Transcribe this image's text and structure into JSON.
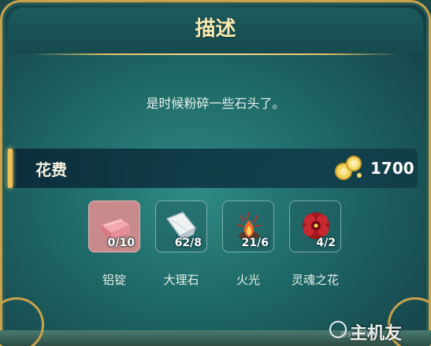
{
  "header": {
    "title": "描述"
  },
  "description": "是时候粉碎一些石头了。",
  "cost": {
    "label": "花费",
    "icon": "gold-coins-icon",
    "value": "1700"
  },
  "materials": [
    {
      "name": "铝锭",
      "count": "0/10",
      "icon": "aluminum-ingot-icon"
    },
    {
      "name": "大理石",
      "count": "62/8",
      "icon": "marble-icon"
    },
    {
      "name": "火光",
      "count": "21/6",
      "icon": "firelight-icon"
    },
    {
      "name": "灵魂之花",
      "count": "4/2",
      "icon": "soul-flower-icon"
    }
  ],
  "watermark": {
    "text": "主机友",
    "sub": "@yzsflfed"
  },
  "colors": {
    "accent_gold": "#f0c050",
    "panel_teal": "#1f6a68",
    "title_gold": "#f7e9b0"
  }
}
